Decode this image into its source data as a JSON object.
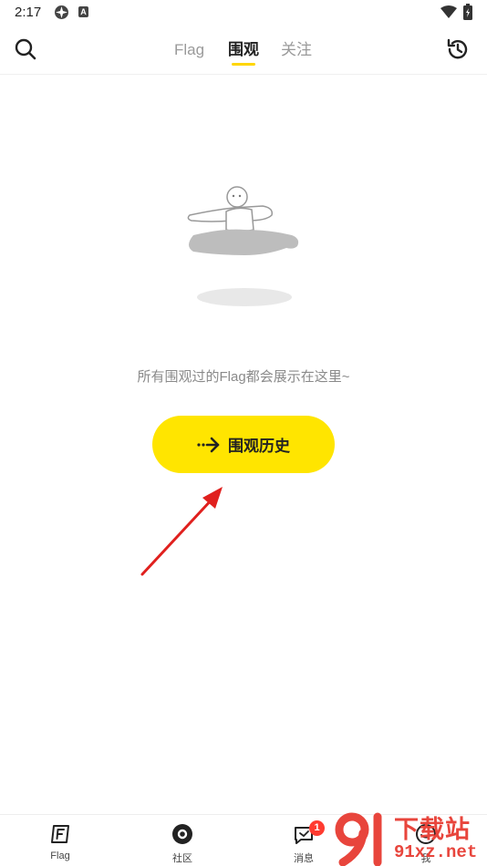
{
  "status_bar": {
    "time": "2:17",
    "badge_letter": "A"
  },
  "top_nav": {
    "tabs": [
      {
        "label": "Flag",
        "active": false
      },
      {
        "label": "围观",
        "active": true
      },
      {
        "label": "关注",
        "active": false
      }
    ],
    "search_icon": "search-icon",
    "history_icon": "history-icon",
    "accent_color": "#ffd600"
  },
  "empty_state": {
    "message": "所有围观过的Flag都会展示在这里~",
    "button_label": "围观历史",
    "button_color": "#ffe500"
  },
  "bottom_nav": {
    "items": [
      {
        "label": "Flag",
        "icon": "flag-icon"
      },
      {
        "label": "社区",
        "icon": "community-icon"
      },
      {
        "label": "消息",
        "icon": "message-icon",
        "badge": "1"
      },
      {
        "label": "我",
        "icon": "profile-icon"
      }
    ]
  },
  "watermark": {
    "title": "下载站",
    "url": "91xz.net"
  }
}
